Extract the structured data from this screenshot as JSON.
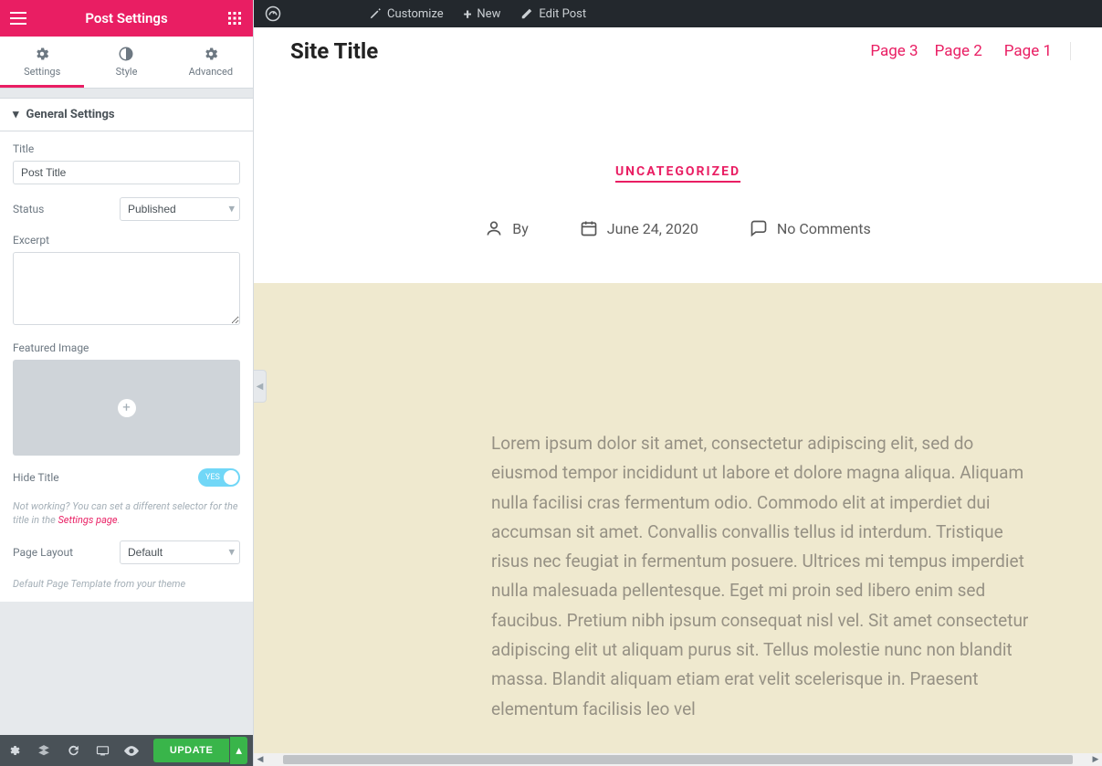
{
  "panel": {
    "title": "Post Settings",
    "tabs": {
      "settings": "Settings",
      "style": "Style",
      "advanced": "Advanced"
    },
    "section_head": "General Settings",
    "fields": {
      "title_label": "Title",
      "title_value": "Post Title",
      "status_label": "Status",
      "status_value": "Published",
      "excerpt_label": "Excerpt",
      "featured_label": "Featured Image",
      "hide_title_label": "Hide Title",
      "hide_title_toggle_text": "YES",
      "help_prefix": "Not working? You can set a different selector for the title in the ",
      "help_link": "Settings page",
      "page_layout_label": "Page Layout",
      "page_layout_value": "Default",
      "page_layout_help": "Default Page Template from your theme"
    },
    "update_button": "UPDATE"
  },
  "adminbar": {
    "customize": "Customize",
    "new": "New",
    "edit": "Edit Post"
  },
  "page": {
    "site_title": "Site Title",
    "nav": [
      "Page 3",
      "Page 2",
      "Page 1"
    ],
    "category": "UNCATEGORIZED",
    "by_label": "By",
    "date": "June 24, 2020",
    "comments": "No Comments",
    "body": "Lorem ipsum dolor sit amet, consectetur adipiscing elit, sed do eiusmod tempor incididunt ut labore et dolore magna aliqua. Aliquam nulla facilisi cras fermentum odio. Commodo elit at imperdiet dui accumsan sit amet. Convallis convallis tellus id interdum. Tristique risus nec feugiat in fermentum posuere. Ultrices mi tempus imperdiet nulla malesuada pellentesque. Eget mi proin sed libero enim sed faucibus. Pretium nibh ipsum consequat nisl vel. Sit amet consectetur adipiscing elit ut aliquam purus sit. Tellus molestie nunc non blandit massa. Blandit aliquam etiam erat velit scelerisque in. Praesent elementum facilisis leo vel"
  },
  "colors": {
    "accent": "#e91e63"
  }
}
